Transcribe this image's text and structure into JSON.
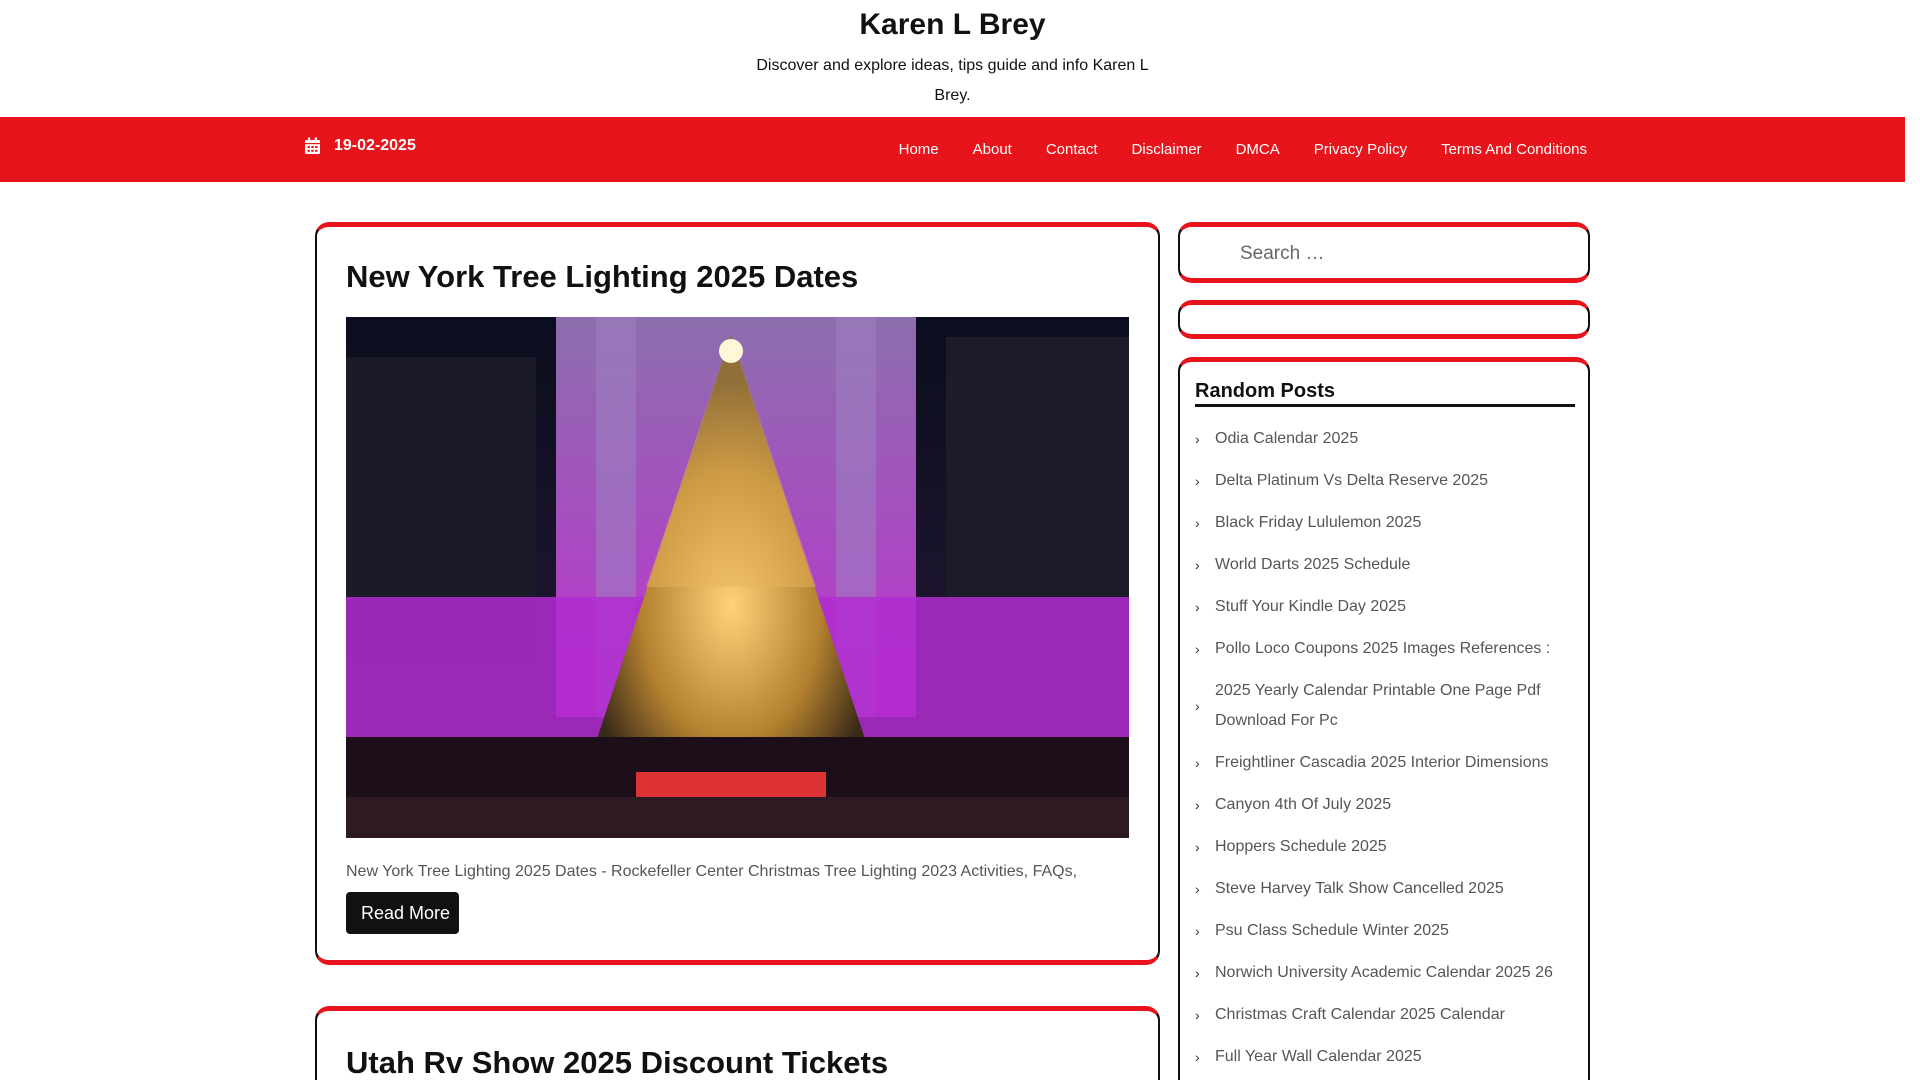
{
  "site": {
    "title": "Karen L Brey",
    "description": "Discover and explore ideas, tips guide and info Karen L Brey."
  },
  "topbar": {
    "date": "19-02-2025",
    "calendar_icon": "calendar-icon",
    "nav": [
      "Home",
      "About",
      "Contact",
      "Disclaimer",
      "DMCA",
      "Privacy Policy",
      "Terms And Conditions"
    ]
  },
  "posts": [
    {
      "title": "New York Tree Lighting 2025 Dates",
      "excerpt": "New York Tree Lighting 2025 Dates - Rockefeller Center Christmas Tree Lighting 2023 Activities, FAQs,",
      "read_more": "Read More"
    },
    {
      "title": "Utah Rv Show 2025 Discount Tickets"
    }
  ],
  "sidebar": {
    "search_placeholder": "Search …",
    "random_title": "Random Posts",
    "random_posts": [
      "Odia Calendar 2025",
      "Delta Platinum Vs Delta Reserve 2025",
      "Black Friday Lululemon 2025",
      "World Darts 2025 Schedule",
      "Stuff Your Kindle Day 2025",
      "Pollo Loco Coupons 2025 Images References :",
      "2025 Yearly Calendar Printable One Page Pdf Download For Pc",
      "Freightliner Cascadia 2025 Interior Dimensions",
      "Canyon 4th Of July 2025",
      "Hoppers Schedule 2025",
      "Steve Harvey Talk Show Cancelled 2025",
      "Psu Class Schedule Winter 2025",
      "Norwich University Academic Calendar 2025 26",
      "Christmas Craft Calendar 2025 Calendar",
      "Full Year Wall Calendar 2025"
    ]
  },
  "colors": {
    "accent": "#e8141b",
    "dark": "#111111"
  }
}
